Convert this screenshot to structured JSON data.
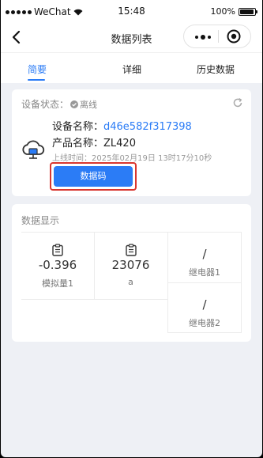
{
  "status_bar": {
    "carrier": "WeChat",
    "time": "15:48",
    "battery": "100%"
  },
  "nav": {
    "title": "数据列表",
    "back_icon": "chevron-left-icon",
    "more_icon": "more-dots-icon",
    "close_icon": "target-circle-icon"
  },
  "tabs": [
    {
      "label": "简要",
      "active": true
    },
    {
      "label": "详细",
      "active": false
    },
    {
      "label": "历史数据",
      "active": false
    }
  ],
  "device": {
    "status_label": "设备状态：",
    "status_value": "离线",
    "name_label": "设备名称：",
    "name_value": "d46e582f317398",
    "product_label": "产品名称：",
    "product_value": "ZL420",
    "online_time_label": "上线时间：",
    "online_time_value": "2025年02月19日 13时17分10秒",
    "button_label": "数据码",
    "accent": "#2b7cf6",
    "highlight": "#d9362f"
  },
  "data_display": {
    "title": "数据显示",
    "items": [
      {
        "value": "-0.396",
        "label": "模拟量1",
        "icon": "clipboard-icon"
      },
      {
        "value": "23076",
        "label": "a",
        "icon": "clipboard-icon"
      },
      {
        "value": "/",
        "label": "继电器1"
      },
      {
        "value": "/",
        "label": "继电器2"
      }
    ]
  }
}
